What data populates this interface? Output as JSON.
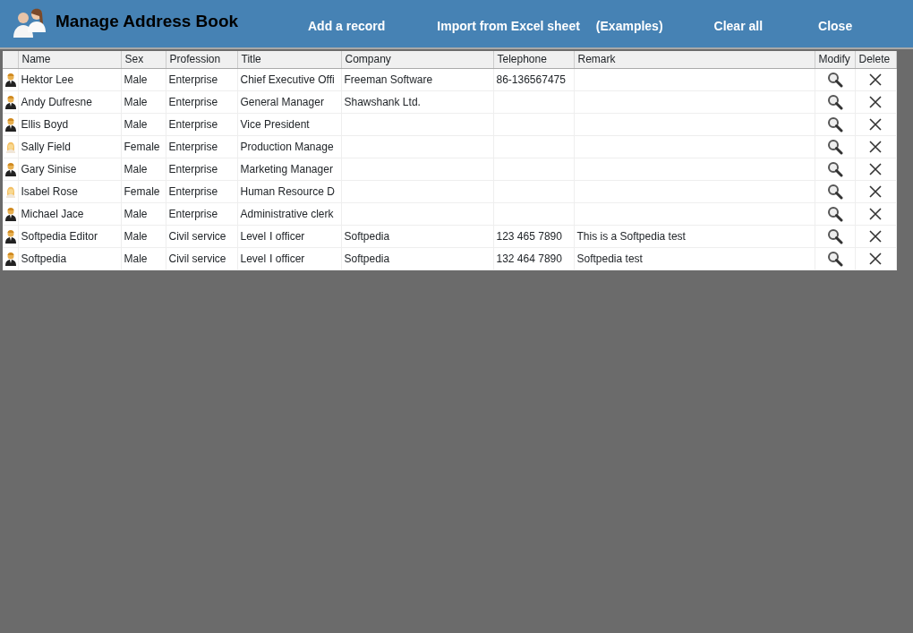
{
  "header": {
    "title": "Manage Address Book",
    "actions": [
      "Add a record",
      "Import from Excel sheet",
      "(Examples)",
      "Clear all",
      "Close"
    ]
  },
  "table": {
    "columns": [
      "Name",
      "Sex",
      "Profession",
      "Title",
      "Company",
      "Telephone",
      "Remark",
      "Modify",
      "Delete"
    ],
    "rows": [
      {
        "kind": "male",
        "cells": [
          "Hektor Lee",
          "Male",
          "Enterprise",
          "Chief Executive Offi",
          "Freeman Software",
          "86-136567475",
          ""
        ]
      },
      {
        "kind": "male",
        "cells": [
          "Andy Dufresne",
          "Male",
          "Enterprise",
          "General Manager",
          "Shawshank Ltd.",
          "",
          ""
        ]
      },
      {
        "kind": "male",
        "cells": [
          "Ellis Boyd",
          "Male",
          "Enterprise",
          "Vice President",
          "",
          "",
          ""
        ]
      },
      {
        "kind": "female",
        "cells": [
          "Sally Field",
          "Female",
          "Enterprise",
          "Production Manage",
          "",
          "",
          ""
        ]
      },
      {
        "kind": "male",
        "cells": [
          "Gary Sinise",
          "Male",
          "Enterprise",
          "Marketing Manager",
          "",
          "",
          ""
        ]
      },
      {
        "kind": "female",
        "cells": [
          "Isabel Rose",
          "Female",
          "Enterprise",
          "Human Resource D",
          "",
          "",
          ""
        ]
      },
      {
        "kind": "male",
        "cells": [
          "Michael Jace",
          "Male",
          "Enterprise",
          "Administrative clerk",
          "",
          "",
          ""
        ]
      },
      {
        "kind": "male",
        "cells": [
          "Softpedia Editor",
          "Male",
          "Civil service",
          "Level Ⅰ officer",
          "Softpedia",
          "123 465 7890",
          "This is a Softpedia test"
        ]
      },
      {
        "kind": "male",
        "cells": [
          "Softpedia",
          "Male",
          "Civil service",
          "Level Ⅰ officer",
          "Softpedia",
          "132 464 7890",
          "Softpedia test"
        ]
      }
    ]
  }
}
